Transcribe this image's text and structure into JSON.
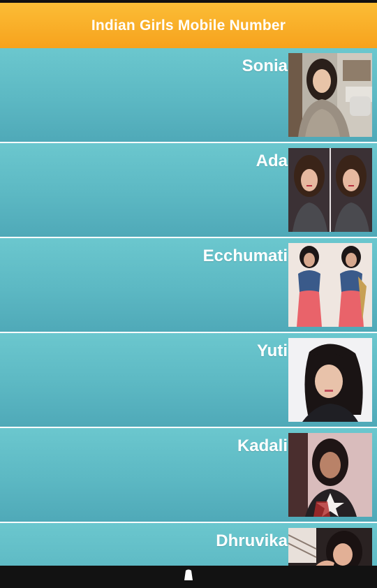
{
  "app": {
    "title": "Indian Girls Mobile Number"
  },
  "contacts": [
    {
      "name": "Sonia",
      "photo": "photo-woman-sweater-street"
    },
    {
      "name": "Ada",
      "photo": "photo-woman-double-selfie"
    },
    {
      "name": "Ecchumati",
      "photo": "photo-woman-saree-double"
    },
    {
      "name": "Yuti",
      "photo": "photo-woman-selfie-white"
    },
    {
      "name": "Kadali",
      "photo": "photo-woman-selfie-dark"
    },
    {
      "name": "Dhruvika",
      "photo": "photo-woman-selfie-window"
    }
  ],
  "navigation": {
    "home_icon": "home-icon"
  },
  "colors": {
    "header_top": "#fbbd36",
    "header_bottom": "#f7a21d",
    "row_top": "#6bc7ce",
    "row_bottom": "#4fa9b8",
    "nav_bar": "#121212"
  }
}
